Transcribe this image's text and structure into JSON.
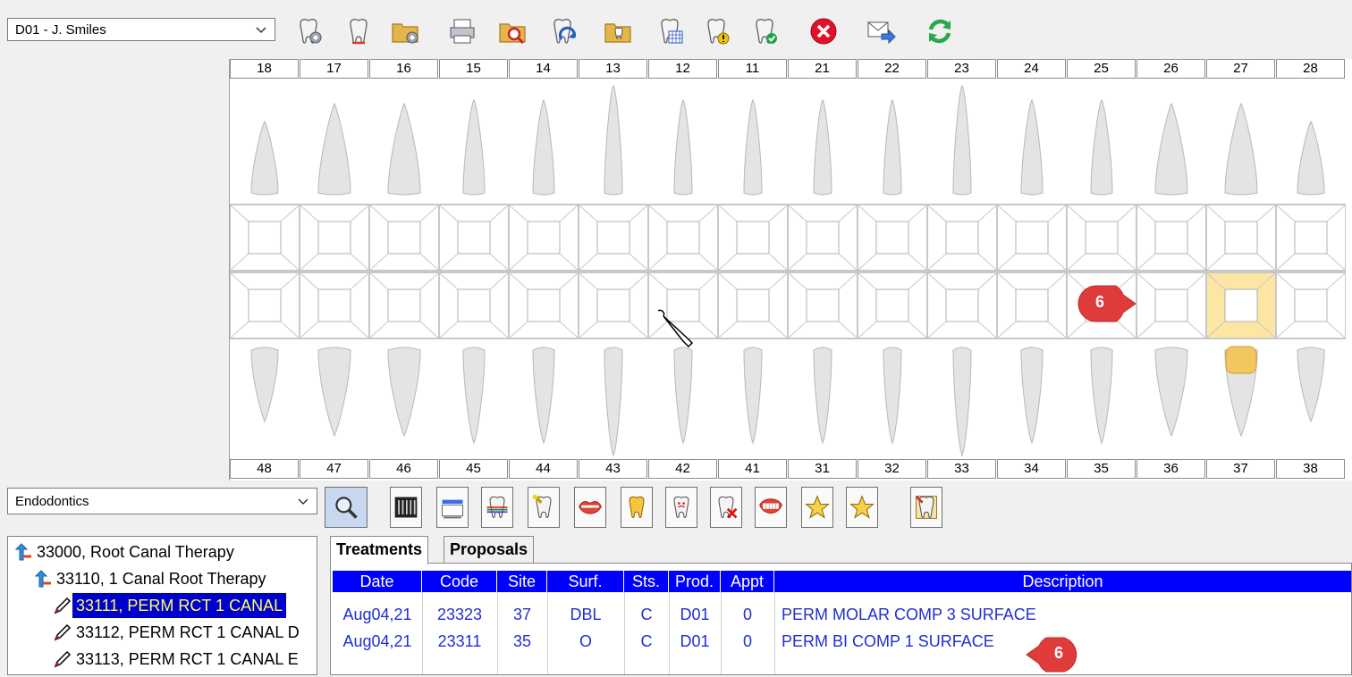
{
  "provider_select": {
    "value": "D01 - J. Smiles"
  },
  "toolbar": [
    "tooth-gear-icon",
    "tooth-xray-icon",
    "folder-gear-icon",
    "printer-icon",
    "folder-search-icon",
    "tooth-refresh-icon",
    "folder-tooth-icon",
    "tooth-calendar-icon",
    "tooth-warning-icon",
    "tooth-check-icon",
    "close-circle-icon",
    "mail-forward-icon",
    "sync-icon"
  ],
  "upper_teeth": [
    "18",
    "17",
    "16",
    "15",
    "14",
    "13",
    "12",
    "11",
    "21",
    "22",
    "23",
    "24",
    "25",
    "26",
    "27",
    "28"
  ],
  "lower_teeth": [
    "48",
    "47",
    "46",
    "45",
    "44",
    "43",
    "42",
    "41",
    "31",
    "32",
    "33",
    "34",
    "35",
    "36",
    "37",
    "38"
  ],
  "highlighted_lower_tooth": "37",
  "callouts": {
    "chart": "6",
    "grid": "6"
  },
  "category_select": {
    "value": "Endodontics"
  },
  "procedure_buttons": [
    "search-icon",
    "xray-film-icon",
    "tooth-cleaning-icon",
    "tooth-braces-icon",
    "tooth-implant-icon",
    "lips-icon",
    "tooth-crown-icon",
    "tooth-face-icon",
    "tooth-extract-icon",
    "denture-icon",
    "star-icon",
    "star-icon",
    "tooth-note-icon"
  ],
  "tree": [
    {
      "label": "33000, Root Canal Therapy",
      "level": 0,
      "icon": "folder-up-icon",
      "selected": false
    },
    {
      "label": "33110, 1 Canal Root Therapy",
      "level": 1,
      "icon": "folder-up-icon",
      "selected": false
    },
    {
      "label": "33111, PERM RCT 1 CANAL",
      "level": 2,
      "icon": "pencil-icon",
      "selected": true
    },
    {
      "label": "33112, PERM RCT 1 CANAL D",
      "level": 2,
      "icon": "pencil-icon",
      "selected": false
    },
    {
      "label": "33113, PERM RCT 1 CANAL E",
      "level": 2,
      "icon": "pencil-icon",
      "selected": false
    }
  ],
  "tabs": {
    "treatments": "Treatments",
    "proposals": "Proposals"
  },
  "grid": {
    "columns": [
      "Date",
      "Code",
      "Site",
      "Surf.",
      "Sts.",
      "Prod.",
      "Appt",
      "Description"
    ],
    "rows": [
      [
        "Aug04,21",
        "23323",
        "37",
        "DBL",
        "C",
        "D01",
        "0",
        "PERM MOLAR COMP 3 SURFACE"
      ],
      [
        "Aug04,21",
        "23311",
        "35",
        "O",
        "C",
        "D01",
        "0",
        "PERM BI COMP 1 SURFACE"
      ]
    ]
  },
  "colors": {
    "grid_header": "#0000ff",
    "grid_text": "#1f2fd0",
    "callout": "#e03b3b",
    "highlight": "#fde6a4",
    "tree_selected": "#0000cc"
  }
}
